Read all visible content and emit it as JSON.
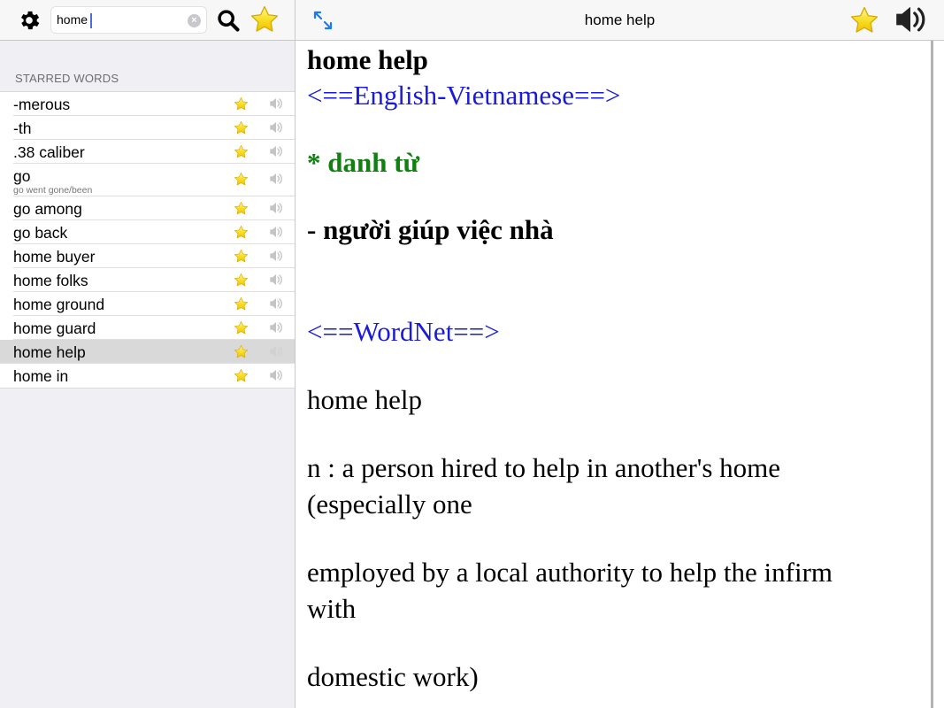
{
  "sidebar": {
    "search": {
      "value": "home",
      "clear_icon": "×"
    },
    "section_header": "STARRED WORDS",
    "words": [
      {
        "word": "-merous",
        "sub": ""
      },
      {
        "word": "-th",
        "sub": ""
      },
      {
        "word": ".38 caliber",
        "sub": ""
      },
      {
        "word": "go",
        "sub": "go went gone/been"
      },
      {
        "word": "go among",
        "sub": ""
      },
      {
        "word": "go back",
        "sub": ""
      },
      {
        "word": "home buyer",
        "sub": ""
      },
      {
        "word": "home folks",
        "sub": ""
      },
      {
        "word": "home ground",
        "sub": ""
      },
      {
        "word": "home guard",
        "sub": ""
      },
      {
        "word": "home help",
        "sub": "",
        "selected": true
      },
      {
        "word": "home in",
        "sub": ""
      }
    ]
  },
  "main": {
    "title": "home help",
    "entry": {
      "headword": "home help",
      "section_en_vi": "<==English-Vietnamese==>",
      "pos": "* danh từ",
      "meaning_vi": "- người giúp việc nhà",
      "section_wordnet": "<==WordNet==>",
      "wn_headword": "home help",
      "wn_def_line1": "n : a person hired to help in another's home",
      "wn_def_line2": "(especially one",
      "wn_def_line3": "employed by a local authority to help the infirm",
      "wn_def_line4": "with",
      "wn_def_line5": "domestic work)"
    }
  },
  "colors": {
    "accent_blue": "#1a7cf5",
    "section_blue": "#1a1adb",
    "pos_green": "#108010",
    "star_yellow": "#f7d51e"
  }
}
